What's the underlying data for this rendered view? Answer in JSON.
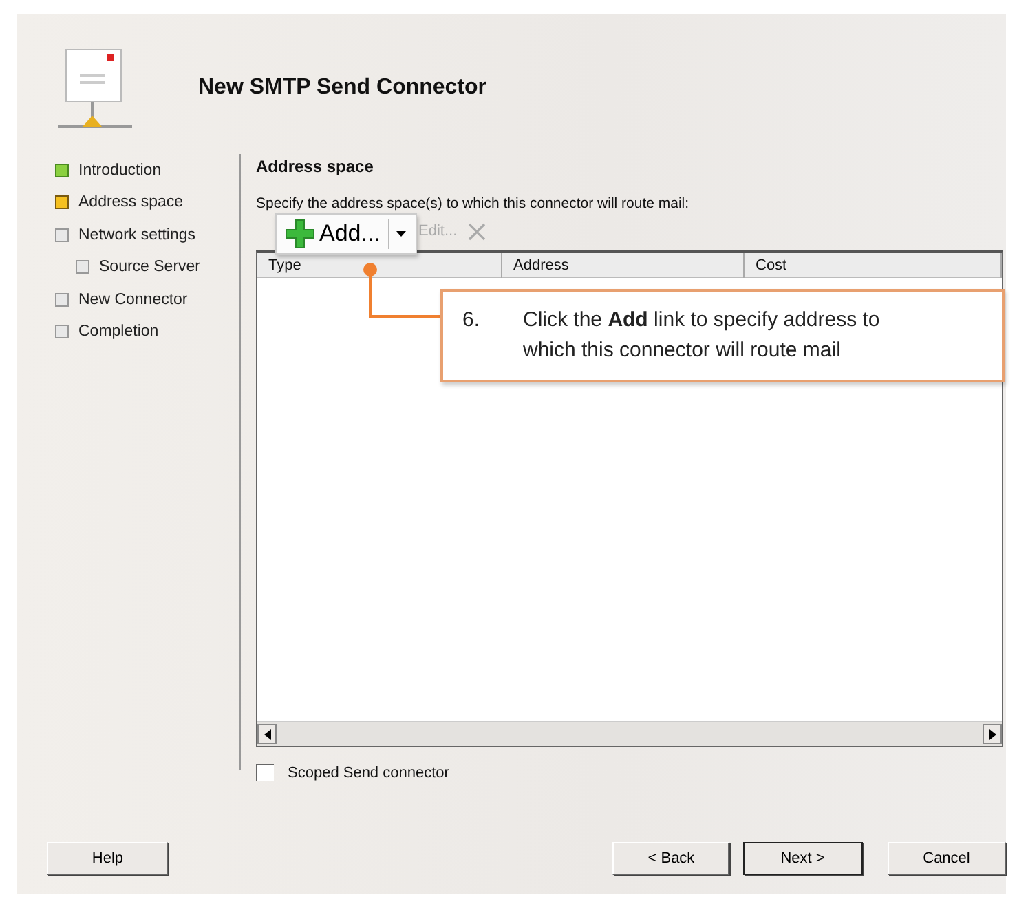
{
  "window": {
    "title": "New SMTP Send Connector"
  },
  "steps": [
    {
      "label": "Introduction",
      "completed": true,
      "selected": false
    },
    {
      "label": "Address space",
      "completed": false,
      "selected": true
    },
    {
      "label": "Network settings",
      "completed": false,
      "selected": false,
      "children": [
        {
          "label": "Source Server",
          "completed": false,
          "selected": false
        }
      ]
    },
    {
      "label": "New Connector",
      "completed": false,
      "selected": false
    },
    {
      "label": "Completion",
      "completed": false,
      "selected": false
    }
  ],
  "page": {
    "heading": "Address space",
    "description": "Specify the address space(s) to which this connector will route mail:"
  },
  "toolbar": {
    "add": "Add...",
    "edit": "Edit...",
    "edit_disabled": true,
    "remove_disabled": true
  },
  "table": {
    "columns": [
      "Type",
      "Address",
      "Cost"
    ]
  },
  "scoped_checkbox": {
    "label": "Scoped Send connector",
    "checked": false
  },
  "callout": {
    "number": "6.",
    "text": "Click the **Add** link to specify address to which this connector will route mail"
  },
  "buttons": [
    {
      "label": "Help",
      "kind": "help"
    },
    {
      "label": "< Back",
      "kind": "back"
    },
    {
      "label": "Next >",
      "kind": "next"
    },
    {
      "label": "Cancel",
      "kind": "cancel"
    }
  ]
}
